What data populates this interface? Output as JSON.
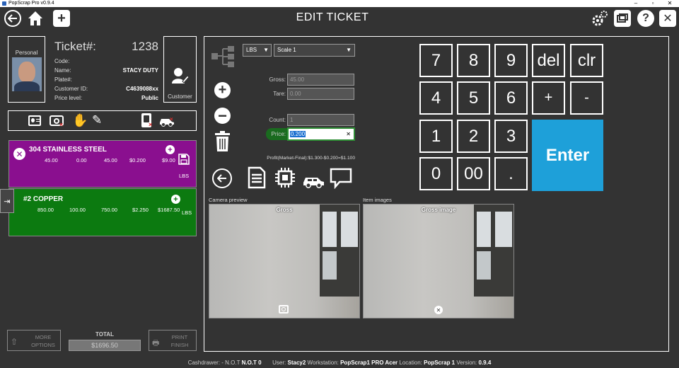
{
  "window": {
    "title": "PopScrap Pro v0.9.4",
    "controls": [
      "–",
      "▫",
      "✕"
    ]
  },
  "header": {
    "title": "EDIT TICKET"
  },
  "customer": {
    "photo_label": "Personal",
    "ticket_label": "Ticket#:",
    "ticket_number": "1238",
    "fields": [
      {
        "label": "Code:",
        "value": ""
      },
      {
        "label": "Name:",
        "value": "STACY DUTY"
      },
      {
        "label": "Plate#:",
        "value": ""
      },
      {
        "label": "Customer ID:",
        "value": "C4639088xx"
      },
      {
        "label": "Price level:",
        "value": "Public"
      }
    ],
    "customer_button_label": "Customer"
  },
  "items": [
    {
      "name": "304 STAINLESS STEEL",
      "gross": "45.00",
      "tare": "0.00",
      "net": "45.00",
      "price": "$0.200",
      "amount": "$9.00",
      "unit": "LBS",
      "color": "#8a0f8f"
    },
    {
      "name": "#2 COPPER",
      "gross": "850.00",
      "tare": "100.00",
      "net": "750.00",
      "price": "$2.250",
      "amount": "$1687.50",
      "unit": "LBS",
      "color": "#0c7a10"
    }
  ],
  "footer_left": {
    "more_options": [
      "MORE",
      "OPTIONS"
    ],
    "total_label": "TOTAL",
    "total_value": "$1696.50",
    "print_finish": [
      "PRINT",
      "FINISH"
    ]
  },
  "scale": {
    "unit": "LBS",
    "scale_name": "Scale 1",
    "gross_label": "Gross:",
    "gross_value": "45.00",
    "tare_label": "Tare:",
    "tare_value": "0.00",
    "count_label": "Count:",
    "count_value": "1",
    "price_label": "Price:",
    "price_value": "0.200",
    "profit_text": "Profit(Market-Final):$1.300-$0.200=$1.100"
  },
  "keypad": {
    "rows": [
      [
        "7",
        "8",
        "9",
        "del",
        "clr"
      ],
      [
        "4",
        "5",
        "6",
        "+",
        "-"
      ],
      [
        "1",
        "2",
        "3"
      ],
      [
        "0",
        "00",
        "."
      ]
    ],
    "enter": "Enter"
  },
  "camera": {
    "label": "Camera preview",
    "caption": "Gross"
  },
  "item_images": {
    "label": "Item images",
    "caption": "Gross image"
  },
  "status": {
    "cashdrawer_label": "Cashdrawer: - N.O.T",
    "cashdrawer_value": "N.O.T 0",
    "user_label": "User:",
    "user_value": "Stacy2",
    "workstation_label": "Workstation:",
    "workstation_value": "PopScrap1 PRO Acer",
    "location_label": "Location:",
    "location_value": "PopScrap 1",
    "version_label": "Version:",
    "version_value": "0.9.4"
  }
}
